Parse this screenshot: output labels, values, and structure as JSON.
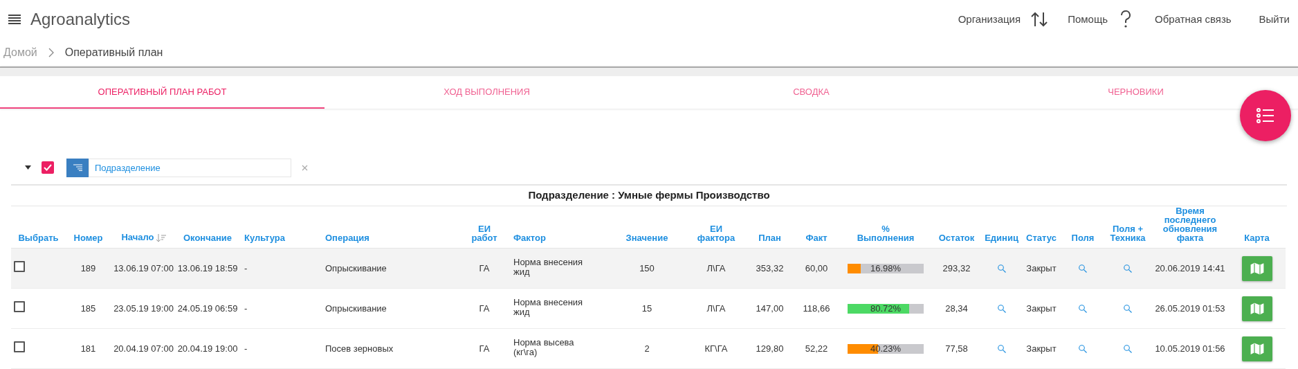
{
  "app": {
    "title": "Agroanalytics",
    "menu": [
      "Организация",
      "Помощь",
      "Обратная связь",
      "Выйти"
    ]
  },
  "breadcrumb": [
    "Домой",
    "Оперативный план"
  ],
  "tabs": [
    {
      "label": "ОПЕРАТИВНЫЙ ПЛАН РАБОТ",
      "selected": true
    },
    {
      "label": "ХОД ВЫПОЛНЕНИЯ",
      "selected": false
    },
    {
      "label": "СВОДКА",
      "selected": false
    },
    {
      "label": "ЧЕРНОВИКИ",
      "selected": false
    }
  ],
  "filter": {
    "expanded": true,
    "checked": true,
    "value": "Подразделение"
  },
  "group_title": "Подразделение : Умные фермы Производство",
  "table": {
    "columns": [
      "Выбрать",
      "Номер",
      "Начало",
      "Окончание",
      "Культура",
      "Операция",
      "ЕИ работ",
      "Фактор",
      "Значение",
      "ЕИ фактора",
      "План",
      "Факт",
      "% Выполнения",
      "Остаток",
      "Единиц",
      "Статус",
      "Поля",
      "Поля + Техника",
      "Время последнего обновления факта",
      "Карта"
    ],
    "rows": [
      {
        "checked": false,
        "hovered": true,
        "number": "189",
        "start": "13.06.19 07:00",
        "end": "13.06.19 18:59",
        "culture": "-",
        "operation": "Опрыскивание",
        "unit": "ГА",
        "factor": "Норма внесения жид",
        "value": "150",
        "factor_unit": "Л\\ГА",
        "plan": "353,32",
        "fact": "60,00",
        "percent": "16.98%",
        "level": 0.17,
        "color": "#ff8c00",
        "remainder": "293,32",
        "status": "Закрыт",
        "updated": "20.06.2019 14:41"
      },
      {
        "checked": false,
        "hovered": false,
        "number": "185",
        "start": "23.05.19 19:00",
        "end": "24.05.19 06:59",
        "culture": "-",
        "operation": "Опрыскивание",
        "unit": "ГА",
        "factor": "Норма внесения жид",
        "value": "15",
        "factor_unit": "Л\\ГА",
        "plan": "147,00",
        "fact": "118,66",
        "percent": "80.72%",
        "level": 0.807,
        "color": "#4cd964",
        "remainder": "28,34",
        "status": "Закрыт",
        "updated": "26.05.2019 01:53"
      },
      {
        "checked": false,
        "hovered": false,
        "number": "181",
        "start": "20.04.19 07:00",
        "end": "20.04.19 19:00",
        "culture": "-",
        "operation": "Посев зерновых",
        "unit": "ГА",
        "factor": "Норма высева (кг\\га)",
        "value": "2",
        "factor_unit": "КГ\\ГА",
        "plan": "129,80",
        "fact": "52,22",
        "percent": "40.23%",
        "level": 0.402,
        "color": "#ff8c00",
        "remainder": "77,58",
        "status": "Закрыт",
        "updated": "10.05.2019 01:56"
      }
    ]
  }
}
